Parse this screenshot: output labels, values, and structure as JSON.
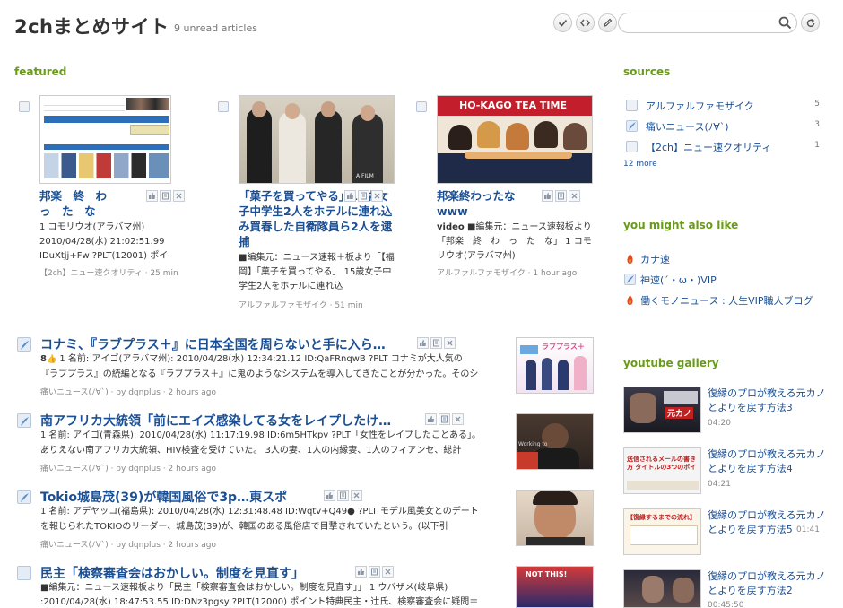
{
  "header": {
    "title": "2chまとめサイト",
    "unread": "9 unread articles",
    "search_placeholder": "",
    "tools": [
      "check-icon",
      "code-icon",
      "pencil-icon",
      "refresh-icon"
    ]
  },
  "featured": {
    "label": "featured",
    "items": [
      {
        "title": "邦楽　終　わ　　っ　た　な",
        "text": "1 コモリウオ(アラバマ州) 2010/04/28(水) 21:02:51.99 IDuXtjj+Fw ?PLT(12001) ポイント",
        "meta": "【2ch】ニュー速クオリティ · 25 min"
      },
      {
        "title": "「菓子を買ってやる」15歳女子中学生2人をホテルに連れ込み買春した自衛隊員ら2人を逮捕",
        "text": "■編集元：ニュース速報＋板より「【福岡】「菓子を買ってやる」 15歳女子中学生2人をホテルに連れ込",
        "meta": "アルファルファモザイク · 51 min",
        "thumb_caption": "A FILM"
      },
      {
        "title": "邦楽終わったな www",
        "text_prefix": "video",
        "text": "■編集元：ニュース速報板より「邦楽　終　わ　っ　た　な」 1 コモリウオ(アラバマ州)",
        "meta": "アルファルファモザイク · 1 hour ago",
        "thumb_caption": "HO-KAGO TEA TIME"
      }
    ]
  },
  "articles": [
    {
      "title": "コナミ、『ラブプラス＋』に日本全国を周らないと手に入ら…",
      "likes": "8",
      "line1": "1 名前: アイゴ(アラバマ州): 2010/04/28(水) 12:34:21.12 ID:QaFRnqwB ?PLT コナミが大人気の",
      "line2": "『ラブプラス』の続編となる『ラブプラス＋』に鬼のようなシステムを導入してきたことが分かった。そのシ",
      "meta": "痛いニュース(ﾉ∀`) · by dqnplus · 2 hours ago",
      "thumb_caption": "ラブプラス＋"
    },
    {
      "title": "南アフリカ大統領「前にエイズ感染してる女をレイプしたけ…",
      "likes": "",
      "line1": "1 名前: アイゴ(青森県): 2010/04/28(水) 11:17:19.98 ID:6m5HTkpv ?PLT「女性をレイプしたことある」。",
      "line2": "ありえない南アフリカ大統領、HIV検査を受けていた。 3人の妻、1人の内縁妻、1人のフィアンセ、総計",
      "meta": "痛いニュース(ﾉ∀`) · by dqnplus · 2 hours ago",
      "thumb_caption": "Working to"
    },
    {
      "title": "Tokio城島茂(39)が韓国風俗で3p…東スポ",
      "likes": "",
      "line1": "1 名前: アデヤッコ(福島県): 2010/04/28(水) 12:31:48.48 ID:Wqtv+Q49● ?PLT モデル風美女とのデート",
      "line2": "を報じられたTOKIOのリーダー、城島茂(39)が、韓国のある風俗店で目撃されていたという。(以下引",
      "meta": "痛いニュース(ﾉ∀`) · by dqnplus · 2 hours ago",
      "thumb_caption": ""
    },
    {
      "title": "民主「検察審査会はおかしい。制度を見直す」",
      "likes": "",
      "line1": "■編集元：ニュース速報板より「民主「検察審査会はおかしい。制度を見直す」」 1 ウバザメ(岐阜県)",
      "line2": ":2010/04/28(水) 18:47:53.55 ID:DNz3pgsy ?PLT(12000) ポイント特典民主・辻氏、検察審査会に疑問＝",
      "meta": "",
      "thumb_caption": "NOT THIS!"
    }
  ],
  "sources": {
    "label": "sources",
    "items": [
      {
        "name": "アルファルファモザイク",
        "count": "5",
        "icon": "rss-icon"
      },
      {
        "name": "痛いニュース(ﾉ∀`)",
        "count": "3",
        "icon": "feather-icon"
      },
      {
        "name": "【2ch】ニュー速クオリティ",
        "count": "1",
        "icon": "rss-icon"
      }
    ],
    "more": "12 more"
  },
  "suggest": {
    "label": "you might also like",
    "items": [
      {
        "name": "カナ速",
        "icon": "flame-icon"
      },
      {
        "name": "神速(´・ω・)VIP",
        "icon": "feather-icon"
      },
      {
        "name": "働くモノニュース : 人生VIP職人ブログ",
        "icon": "flame-icon"
      }
    ]
  },
  "youtube": {
    "label": "youtube gallery",
    "items": [
      {
        "title": "復縁のプロが教える元カノとよりを戻す方法3",
        "duration": "04:20",
        "caption": "元カノ"
      },
      {
        "title": "復縁のプロが教える元カノとよりを戻す方法4",
        "duration": "04:21",
        "caption": "送信されるメールの書き方 タイトルの3つのポイ"
      },
      {
        "title": "復縁のプロが教える元カノとよりを戻す方法5",
        "duration": "01:41",
        "caption": "【復縁するまでの流れ】"
      },
      {
        "title": "復縁のプロが教える元カノとよりを戻す方法2",
        "duration": "00:45:50",
        "caption": ""
      }
    ]
  },
  "colors": {
    "link": "#1a4f94",
    "section_label": "#6a9a1a",
    "meta": "#888888"
  }
}
